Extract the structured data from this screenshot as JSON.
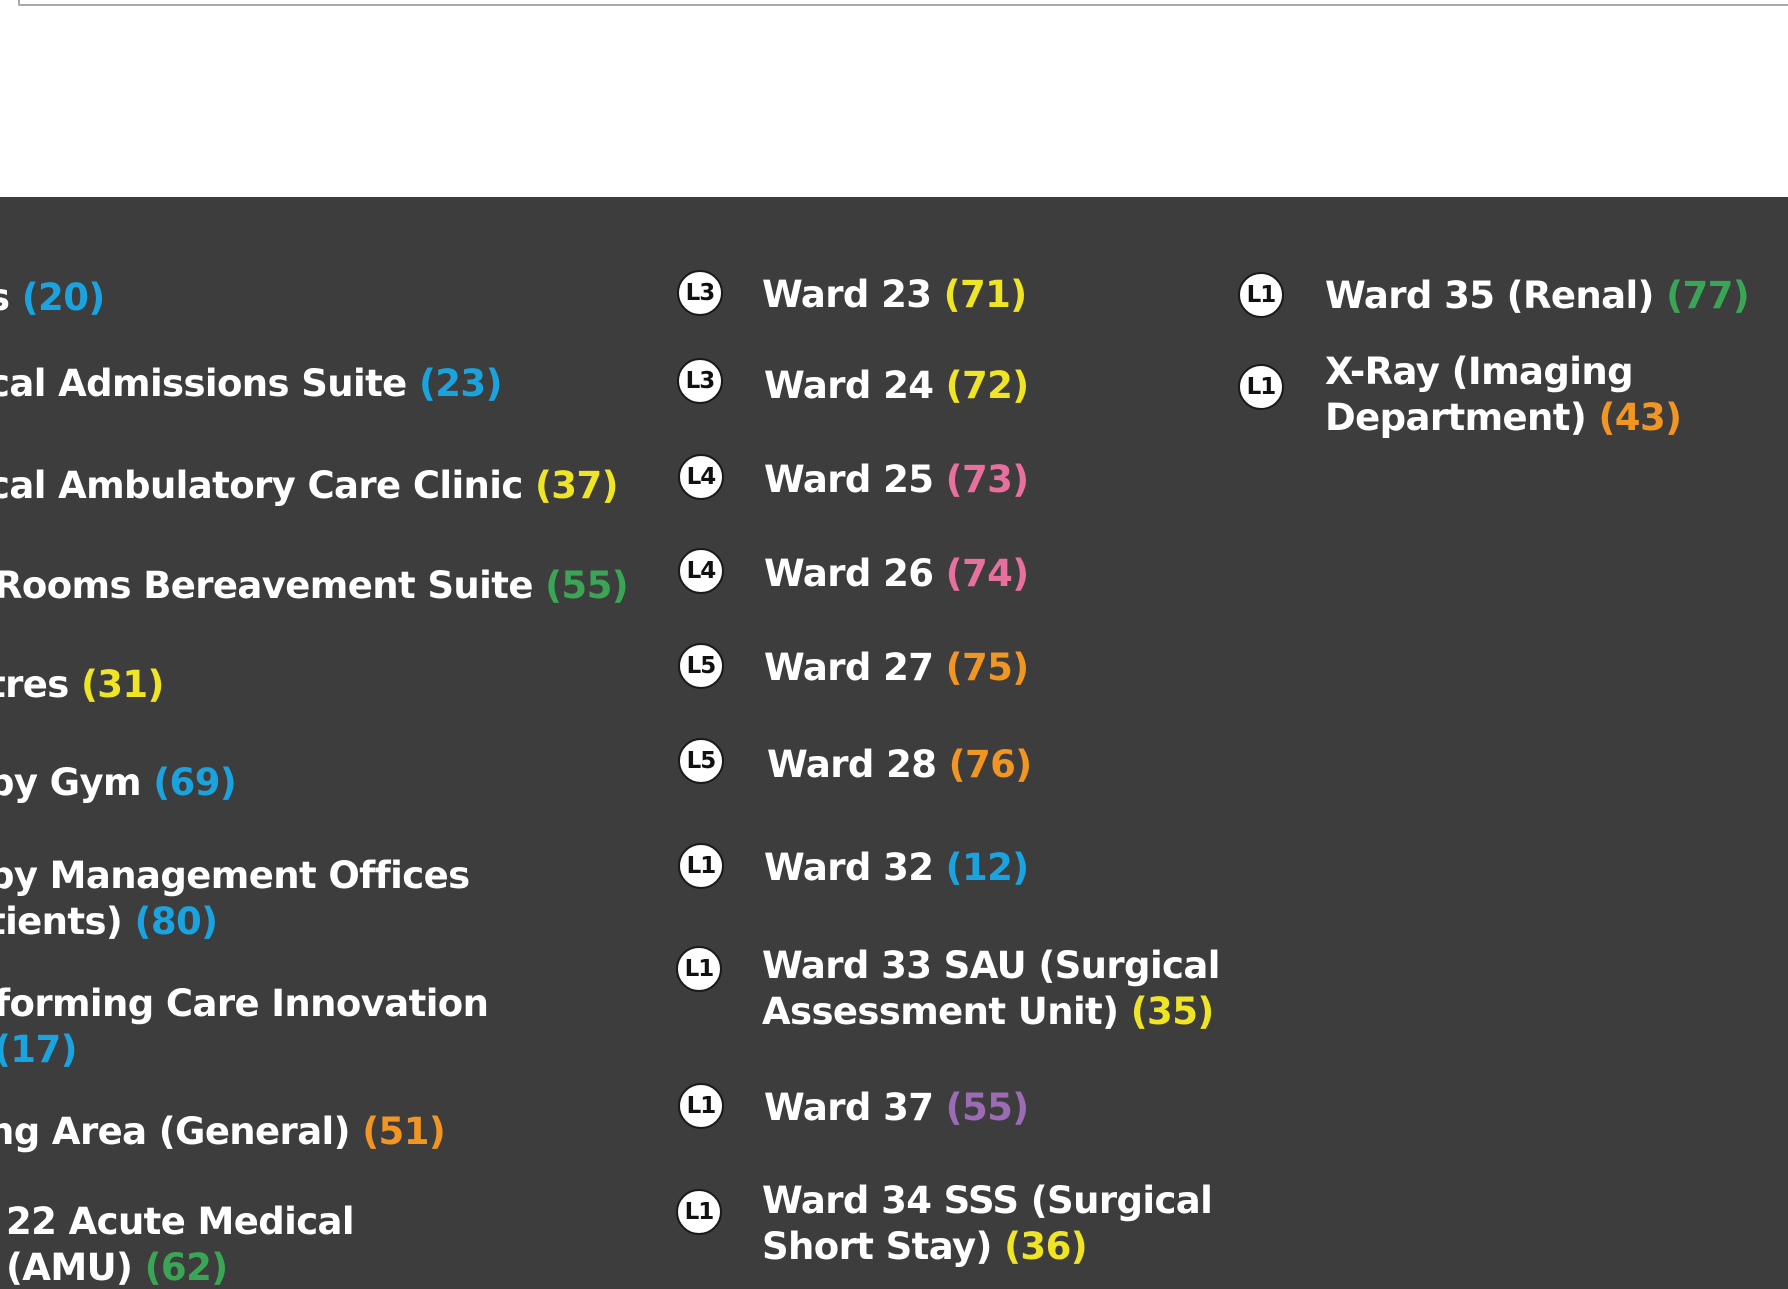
{
  "colors": {
    "blue": "#1ba3df",
    "yellow": "#f0e524",
    "green": "#3aa655",
    "pink": "#e8709e",
    "orange": "#f29623",
    "purple": "#9b6bb3",
    "panel_bg": "#3d3d3d"
  },
  "left_column": [
    {
      "name": "s",
      "number": "(20)",
      "color": "blue"
    },
    {
      "name": "cal Admissions Suite",
      "number": "(23)",
      "color": "blue"
    },
    {
      "name": "cal Ambulatory Care Clinic",
      "number": "(37)",
      "color": "yellow"
    },
    {
      "name": " Rooms Bereavement Suite",
      "number": "(55)",
      "color": "green"
    },
    {
      "name": "tres",
      "number": "(31)",
      "color": "yellow"
    },
    {
      "name": "py Gym",
      "number": "(69)",
      "color": "blue"
    },
    {
      "name_line1": "py Management Offices",
      "name_line2": "tients)",
      "number": "(80)",
      "color": "blue"
    },
    {
      "name_line1": "forming Care Innovation",
      "name_line2": "",
      "number": "(17)",
      "color": "blue"
    },
    {
      "name": "ng Area (General)",
      "number": "(51)",
      "color": "orange"
    },
    {
      "name_line1": "22 Acute Medical",
      "name_line2": "(AMU)",
      "number": "(62)",
      "color": "green"
    }
  ],
  "middle_column": [
    {
      "level": "L3",
      "name": "Ward 23",
      "number": "(71)",
      "color": "yellow"
    },
    {
      "level": "L3",
      "name": "Ward 24",
      "number": "(72)",
      "color": "yellow"
    },
    {
      "level": "L4",
      "name": "Ward 25",
      "number": "(73)",
      "color": "pink"
    },
    {
      "level": "L4",
      "name": "Ward 26",
      "number": "(74)",
      "color": "pink"
    },
    {
      "level": "L5",
      "name": "Ward 27",
      "number": "(75)",
      "color": "orange"
    },
    {
      "level": "L5",
      "name": "Ward 28",
      "number": "(76)",
      "color": "orange"
    },
    {
      "level": "L1",
      "name": "Ward 32",
      "number": "(12)",
      "color": "blue"
    },
    {
      "level": "L1",
      "name_line1": "Ward 33 SAU (Surgical",
      "name_line2": "Assessment Unit)",
      "number": "(35)",
      "color": "yellow"
    },
    {
      "level": "L1",
      "name": "Ward 37",
      "number": "(55)",
      "color": "purple"
    },
    {
      "level": "L1",
      "name_line1": "Ward 34 SSS (Surgical",
      "name_line2": "Short Stay)",
      "number": "(36)",
      "color": "yellow"
    }
  ],
  "right_column": [
    {
      "level": "L1",
      "name": "Ward 35 (Renal)",
      "number": "(77)",
      "color": "green"
    },
    {
      "level": "L1",
      "name_line1": "X-Ray (Imaging",
      "name_line2": "Department)",
      "number": "(43)",
      "color": "orange"
    }
  ]
}
